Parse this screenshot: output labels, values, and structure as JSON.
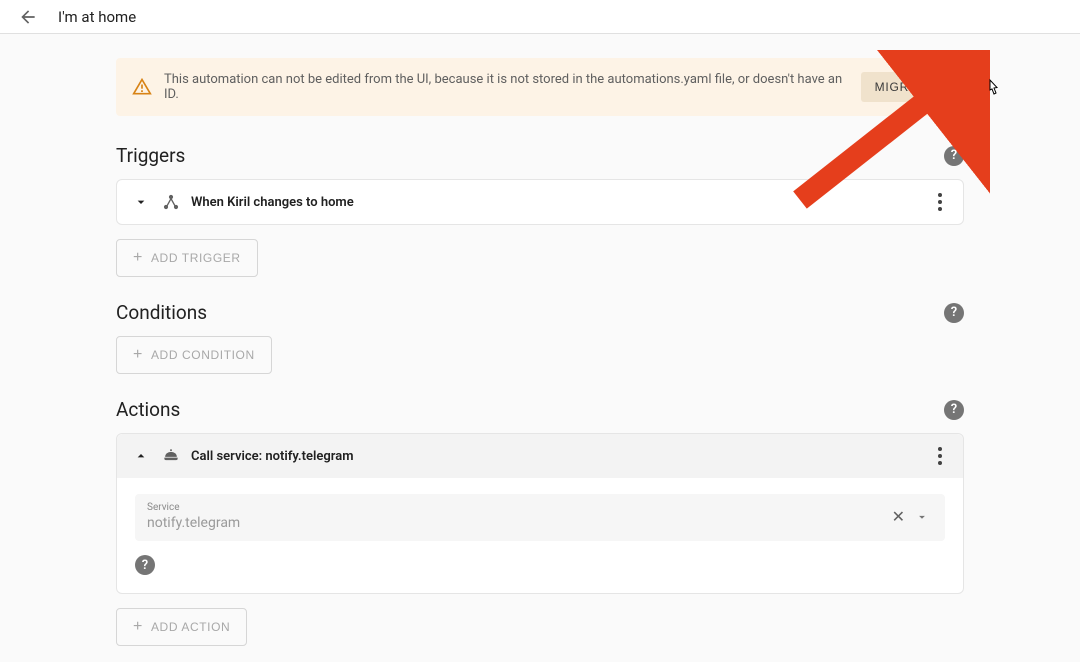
{
  "header": {
    "title": "I'm at home"
  },
  "alert": {
    "message": "This automation can not be edited from the UI, because it is not stored in the automations.yaml file, or doesn't have an ID.",
    "action_label": "MIGRATE"
  },
  "sections": {
    "triggers": {
      "title": "Triggers",
      "items": [
        {
          "label": "When Kiril changes to home"
        }
      ],
      "add_label": "ADD TRIGGER"
    },
    "conditions": {
      "title": "Conditions",
      "add_label": "ADD CONDITION"
    },
    "actions": {
      "title": "Actions",
      "items": [
        {
          "label": "Call service: notify.telegram",
          "service_field_label": "Service",
          "service_value": "notify.telegram"
        }
      ],
      "add_label": "ADD ACTION"
    }
  }
}
